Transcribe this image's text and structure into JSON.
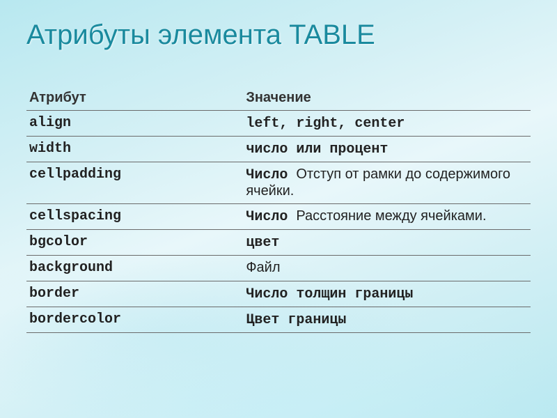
{
  "title": "Атрибуты элемента TABLE",
  "headers": {
    "attr": "Атрибут",
    "value": "Значение"
  },
  "rows": [
    {
      "attr": "align",
      "value_mono": "left, right, center",
      "value_sans": ""
    },
    {
      "attr": "width",
      "value_mono": "число или процент",
      "value_sans": ""
    },
    {
      "attr": "cellpadding",
      "value_mono": "Число ",
      "value_sans": "Отступ от рамки до содержимого ячейки."
    },
    {
      "attr": "cellspacing",
      "value_mono": "Число ",
      "value_sans": "Расстояние между ячейками."
    },
    {
      "attr": "bgcolor",
      "value_mono": "цвет",
      "value_sans": ""
    },
    {
      "attr": "background",
      "value_mono": "",
      "value_sans": "Файл"
    },
    {
      "attr": "border",
      "value_mono": "Число толщин границы",
      "value_sans": ""
    },
    {
      "attr": "bordercolor",
      "value_mono": "Цвет границы",
      "value_sans": ""
    }
  ]
}
